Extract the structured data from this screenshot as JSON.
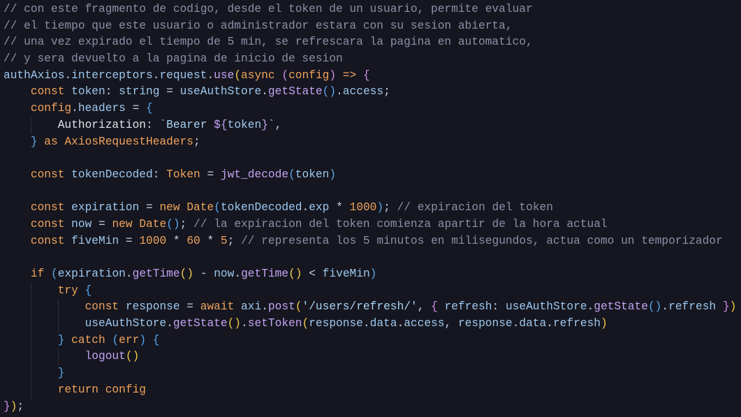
{
  "editor": {
    "lines": [
      [
        [
          "// con este fragmento de codigo, desde el token de un usuario, permite evaluar",
          "c"
        ]
      ],
      [
        [
          "// el tiempo que este usuario o administrador estara con su sesion abierta,",
          "c"
        ]
      ],
      [
        [
          "// una vez expirado el tiempo de 5 min, se refrescara la pagina en automatico,",
          "c"
        ]
      ],
      [
        [
          "// y sera devuelto a la pagina de inicio de sesion",
          "c"
        ]
      ],
      [
        [
          "authAxios",
          "v"
        ],
        [
          ".",
          "p"
        ],
        [
          "interceptors",
          "v"
        ],
        [
          ".",
          "p"
        ],
        [
          "request",
          "v"
        ],
        [
          ".",
          "p"
        ],
        [
          "use",
          "f"
        ],
        [
          "(",
          "b1"
        ],
        [
          "async ",
          "k"
        ],
        [
          "(",
          "b2"
        ],
        [
          "config",
          "k"
        ],
        [
          ")",
          "b2"
        ],
        [
          " => ",
          "k"
        ],
        [
          "{",
          "b2"
        ]
      ],
      [
        [
          "    ",
          "p"
        ],
        [
          "const ",
          "k"
        ],
        [
          "token",
          "v"
        ],
        [
          ": ",
          "p"
        ],
        [
          "string",
          "v"
        ],
        [
          " = ",
          "p"
        ],
        [
          "useAuthStore",
          "v"
        ],
        [
          ".",
          "p"
        ],
        [
          "getState",
          "f"
        ],
        [
          "()",
          "b3"
        ],
        [
          ".",
          "p"
        ],
        [
          "access",
          "v"
        ],
        [
          ";",
          "p"
        ]
      ],
      [
        [
          "    ",
          "p"
        ],
        [
          "config",
          "k"
        ],
        [
          ".",
          "p"
        ],
        [
          "headers",
          "v"
        ],
        [
          " = ",
          "p"
        ],
        [
          "{",
          "b3"
        ]
      ],
      [
        [
          "        ",
          "p"
        ],
        [
          "Authorization",
          "w"
        ],
        [
          ": ",
          "p"
        ],
        [
          "`Bearer ",
          "s"
        ],
        [
          "${",
          "f"
        ],
        [
          "token",
          "v"
        ],
        [
          "}",
          "f"
        ],
        [
          "`",
          "s"
        ],
        [
          ",",
          "p"
        ]
      ],
      [
        [
          "    ",
          "p"
        ],
        [
          "}",
          "b3"
        ],
        [
          " as ",
          "k"
        ],
        [
          "AxiosRequestHeaders",
          "t"
        ],
        [
          ";",
          "p"
        ]
      ],
      [
        [
          "",
          "p"
        ]
      ],
      [
        [
          "    ",
          "p"
        ],
        [
          "const ",
          "k"
        ],
        [
          "tokenDecoded",
          "v"
        ],
        [
          ": ",
          "p"
        ],
        [
          "Token",
          "t"
        ],
        [
          " = ",
          "p"
        ],
        [
          "jwt_decode",
          "f"
        ],
        [
          "(",
          "b3"
        ],
        [
          "token",
          "v"
        ],
        [
          ")",
          "b3"
        ]
      ],
      [
        [
          "",
          "p"
        ]
      ],
      [
        [
          "    ",
          "p"
        ],
        [
          "const ",
          "k"
        ],
        [
          "expiration",
          "v"
        ],
        [
          " = ",
          "p"
        ],
        [
          "new ",
          "k"
        ],
        [
          "Date",
          "t"
        ],
        [
          "(",
          "b3"
        ],
        [
          "tokenDecoded",
          "v"
        ],
        [
          ".",
          "p"
        ],
        [
          "exp",
          "v"
        ],
        [
          " * ",
          "p"
        ],
        [
          "1000",
          "n"
        ],
        [
          ")",
          "b3"
        ],
        [
          "; ",
          "p"
        ],
        [
          "// expiracion del token",
          "c"
        ]
      ],
      [
        [
          "    ",
          "p"
        ],
        [
          "const ",
          "k"
        ],
        [
          "now",
          "v"
        ],
        [
          " = ",
          "p"
        ],
        [
          "new ",
          "k"
        ],
        [
          "Date",
          "t"
        ],
        [
          "()",
          "b3"
        ],
        [
          "; ",
          "p"
        ],
        [
          "// la expiracion del token comienza apartir de la hora actual",
          "c"
        ]
      ],
      [
        [
          "    ",
          "p"
        ],
        [
          "const ",
          "k"
        ],
        [
          "fiveMin",
          "v"
        ],
        [
          " = ",
          "p"
        ],
        [
          "1000",
          "n"
        ],
        [
          " * ",
          "p"
        ],
        [
          "60",
          "n"
        ],
        [
          " * ",
          "p"
        ],
        [
          "5",
          "n"
        ],
        [
          "; ",
          "p"
        ],
        [
          "// representa los 5 minutos en milisegundos, actua como un temporizador",
          "c"
        ]
      ],
      [
        [
          "",
          "p"
        ]
      ],
      [
        [
          "    ",
          "p"
        ],
        [
          "if ",
          "k"
        ],
        [
          "(",
          "b3"
        ],
        [
          "expiration",
          "v"
        ],
        [
          ".",
          "p"
        ],
        [
          "getTime",
          "f"
        ],
        [
          "()",
          "b1"
        ],
        [
          " - ",
          "p"
        ],
        [
          "now",
          "v"
        ],
        [
          ".",
          "p"
        ],
        [
          "getTime",
          "f"
        ],
        [
          "()",
          "b1"
        ],
        [
          " < ",
          "p"
        ],
        [
          "fiveMin",
          "v"
        ],
        [
          ")",
          "b3"
        ]
      ],
      [
        [
          "        ",
          "p"
        ],
        [
          "try ",
          "k"
        ],
        [
          "{",
          "b3"
        ]
      ],
      [
        [
          "            ",
          "p"
        ],
        [
          "const ",
          "k"
        ],
        [
          "response",
          "v"
        ],
        [
          " = ",
          "p"
        ],
        [
          "await ",
          "k"
        ],
        [
          "axi",
          "v"
        ],
        [
          ".",
          "p"
        ],
        [
          "post",
          "f"
        ],
        [
          "(",
          "b1"
        ],
        [
          "'/users/refresh/'",
          "s"
        ],
        [
          ", ",
          "p"
        ],
        [
          "{",
          "b2"
        ],
        [
          " refresh",
          "v"
        ],
        [
          ": ",
          "p"
        ],
        [
          "useAuthStore",
          "v"
        ],
        [
          ".",
          "p"
        ],
        [
          "getState",
          "f"
        ],
        [
          "()",
          "b3"
        ],
        [
          ".",
          "p"
        ],
        [
          "refresh ",
          "v"
        ],
        [
          "}",
          "b2"
        ],
        [
          ")",
          "b1"
        ]
      ],
      [
        [
          "            ",
          "p"
        ],
        [
          "useAuthStore",
          "v"
        ],
        [
          ".",
          "p"
        ],
        [
          "getState",
          "f"
        ],
        [
          "()",
          "b1"
        ],
        [
          ".",
          "p"
        ],
        [
          "setToken",
          "f"
        ],
        [
          "(",
          "b1"
        ],
        [
          "response",
          "v"
        ],
        [
          ".",
          "p"
        ],
        [
          "data",
          "v"
        ],
        [
          ".",
          "p"
        ],
        [
          "access",
          "v"
        ],
        [
          ", ",
          "p"
        ],
        [
          "response",
          "v"
        ],
        [
          ".",
          "p"
        ],
        [
          "data",
          "v"
        ],
        [
          ".",
          "p"
        ],
        [
          "refresh",
          "v"
        ],
        [
          ")",
          "b1"
        ]
      ],
      [
        [
          "        ",
          "p"
        ],
        [
          "}",
          "b3"
        ],
        [
          " catch ",
          "k"
        ],
        [
          "(",
          "b3"
        ],
        [
          "err",
          "k"
        ],
        [
          ")",
          "b3"
        ],
        [
          " ",
          "p"
        ],
        [
          "{",
          "b3"
        ]
      ],
      [
        [
          "            ",
          "p"
        ],
        [
          "logout",
          "f"
        ],
        [
          "()",
          "b1"
        ]
      ],
      [
        [
          "        ",
          "p"
        ],
        [
          "}",
          "b3"
        ]
      ],
      [
        [
          "        ",
          "p"
        ],
        [
          "return ",
          "k"
        ],
        [
          "config",
          "k"
        ]
      ],
      [
        [
          "}",
          "b2"
        ],
        [
          ")",
          "b1"
        ],
        [
          ";",
          "p"
        ]
      ]
    ]
  }
}
